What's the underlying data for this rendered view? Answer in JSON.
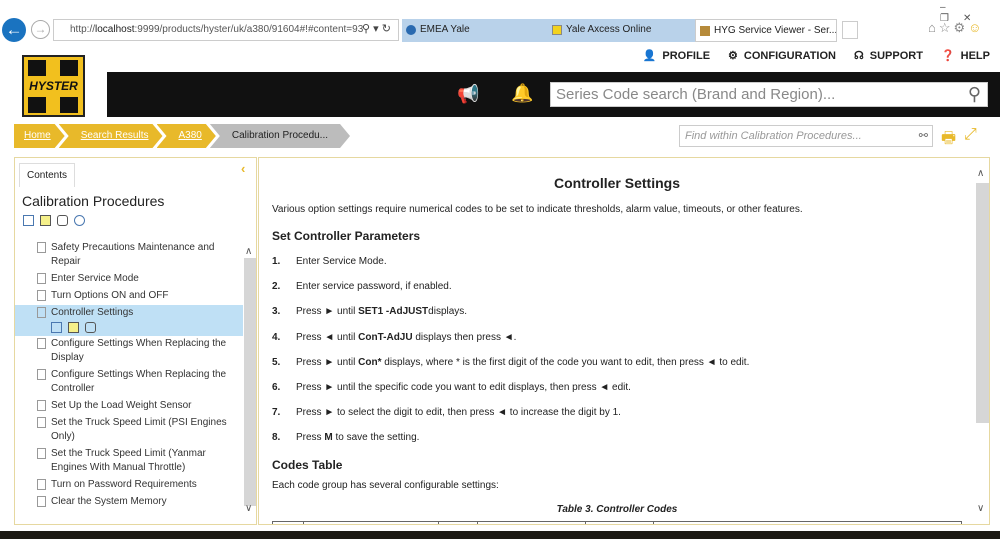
{
  "browser": {
    "url_prefix": "http://",
    "url_host": "localhost",
    "url_rest": ":9999/products/hyster/uk/a380/91604#!#content=93",
    "tabs": [
      {
        "label": "EMEA Yale"
      },
      {
        "label": "Yale Axcess Online"
      },
      {
        "label": "HYG Service Viewer - Ser...",
        "close": "×"
      }
    ]
  },
  "topnav": {
    "profile": "PROFILE",
    "configuration": "CONFIGURATION",
    "support": "SUPPORT",
    "help": "HELP"
  },
  "logo": "HYSTER",
  "search": {
    "placeholder": "Series Code search (Brand and Region)..."
  },
  "breadcrumb": [
    "Home",
    "Search Results",
    "A380",
    "Calibration Procedu..."
  ],
  "find": {
    "placeholder": "Find within Calibration Procedures..."
  },
  "sidebar": {
    "tab": "Contents",
    "title": "Calibration Procedures",
    "items": [
      "Safety Precautions Maintenance and Repair",
      "Enter Service Mode",
      "Turn Options ON and OFF",
      "Controller Settings",
      "Configure Settings When Replacing the Display",
      "Configure Settings When Replacing the Controller",
      "Set Up the Load Weight Sensor",
      "Set the Truck Speed Limit (PSI Engines Only)",
      "Set the Truck Speed Limit (Yanmar Engines With Manual Throttle)",
      "Turn on Password Requirements",
      "Clear the System Memory"
    ]
  },
  "content": {
    "title": "Controller Settings",
    "intro": "Various option settings require numerical codes to be set to indicate thresholds, alarm value, timeouts, or other features.",
    "h_params": "Set Controller Parameters",
    "steps": [
      {
        "n": "1.",
        "a": "Enter Service Mode.",
        "b": "",
        "c": ""
      },
      {
        "n": "2.",
        "a": "Enter service password, if enabled.",
        "b": "",
        "c": ""
      },
      {
        "n": "3.",
        "a": "Press ► until ",
        "b": "SET1 -AdJUST",
        "c": "displays."
      },
      {
        "n": "4.",
        "a": "Press ◄ until ",
        "b": "ConT-AdJU",
        "c": " displays then press ◄."
      },
      {
        "n": "5.",
        "a": "Press ► until ",
        "b": "Con*",
        "c": " displays, where * is the first digit of the code you want to edit, then press ◄ to edit."
      },
      {
        "n": "6.",
        "a": "Press ► until the specific code you want to edit displays, then press ◄ edit.",
        "b": "",
        "c": ""
      },
      {
        "n": "7.",
        "a": "Press ► to select the digit to edit, then press ◄ to increase the digit by 1.",
        "b": "",
        "c": ""
      },
      {
        "n": "8.",
        "a": "Press ",
        "b": "M",
        "c": " to save the setting."
      }
    ],
    "h_codes": "Codes Table",
    "codes_intro": "Each code group has several configurable settings:",
    "table_caption": "Table 3. Controller Codes"
  }
}
